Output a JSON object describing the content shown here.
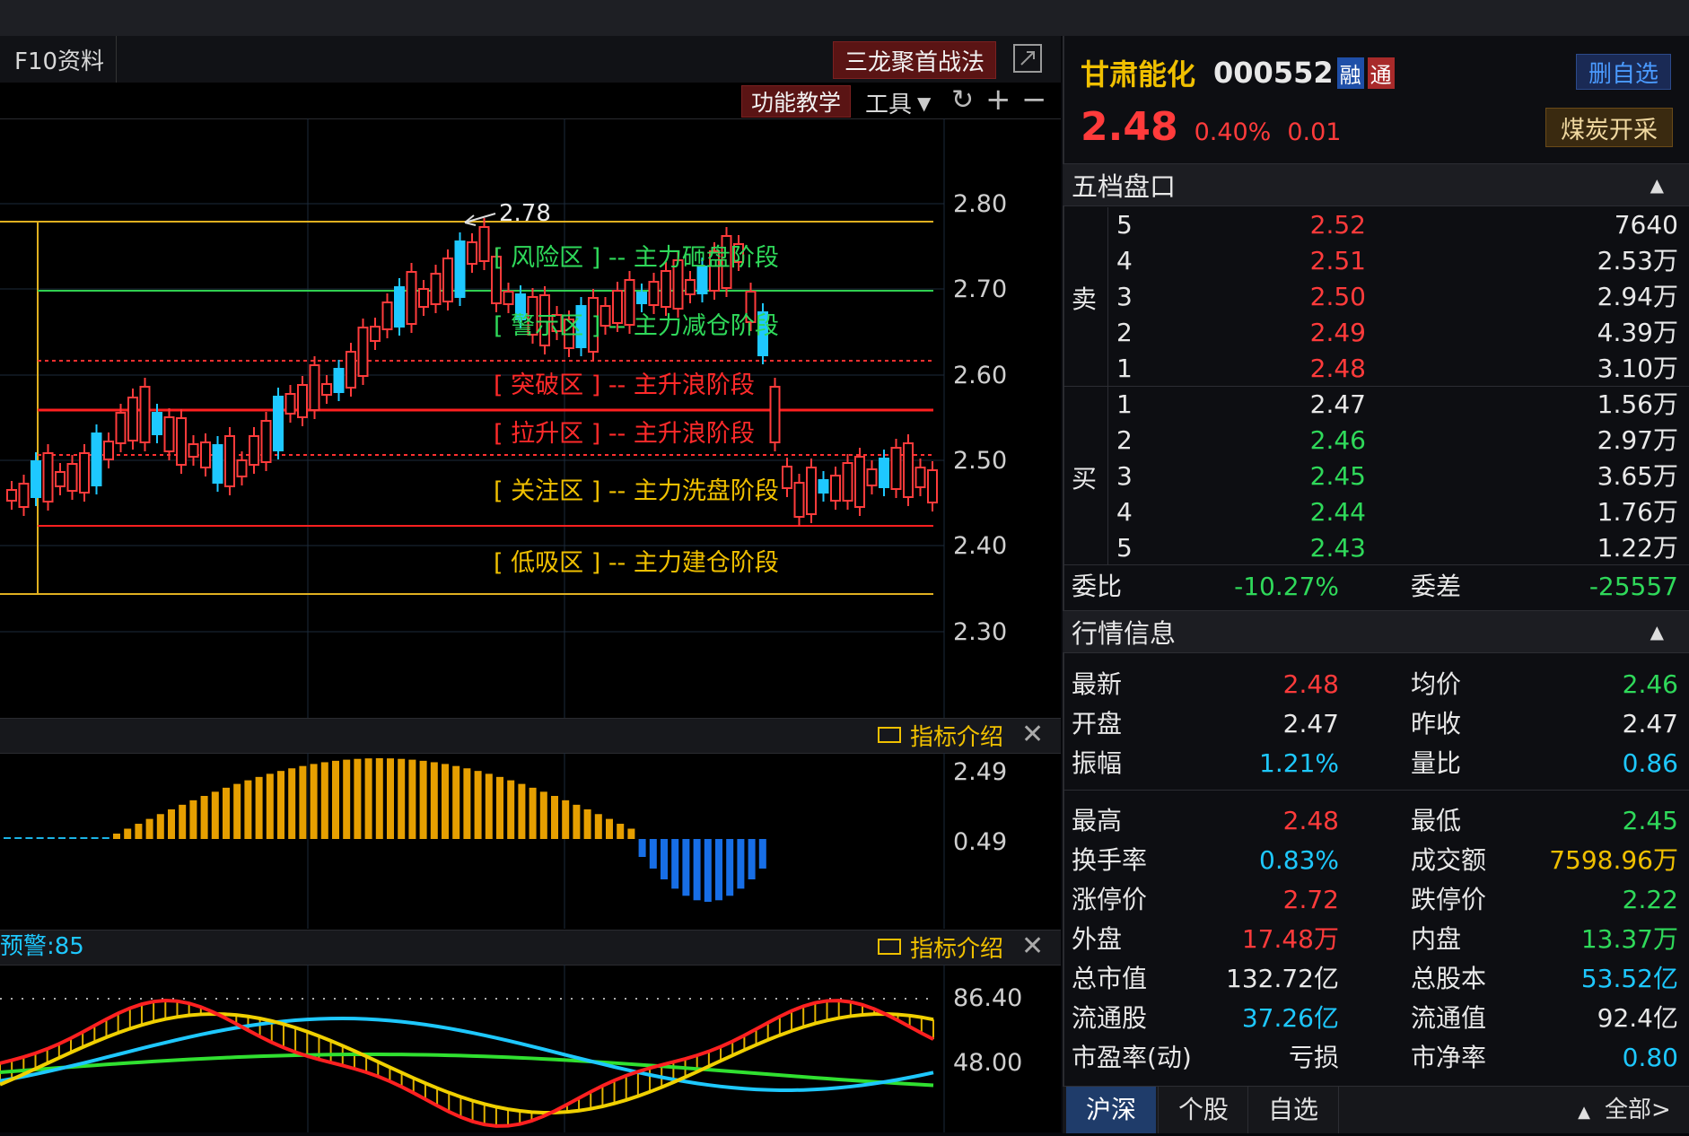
{
  "toolbar": {
    "f10": "F10资料",
    "strategy": "三龙聚首战法",
    "teach": "功能教学",
    "tools": "工具"
  },
  "chart": {
    "price_labels": [
      "2.80",
      "2.70",
      "2.60",
      "2.50",
      "2.40",
      "2.30"
    ],
    "high_marker": "2.78",
    "zones": [
      {
        "text": "[ 风险区 ] -- 主力砸盘阶段",
        "color": "#2fd95a"
      },
      {
        "text": "[ 警示区 ] -- 主力减仓阶段",
        "color": "#2fd95a"
      },
      {
        "text": "[ 突破区 ] -- 主升浪阶段",
        "color": "#ff2a2a"
      },
      {
        "text": "[ 拉升区 ] -- 主升浪阶段",
        "color": "#ff2a2a"
      },
      {
        "text": "[ 关注区 ] -- 主力洗盘阶段",
        "color": "#f0c000"
      },
      {
        "text": "[ 低吸区 ] -- 主力建仓阶段",
        "color": "#f0c000"
      }
    ],
    "ind1_label": "指标介绍",
    "ind1_axis": [
      "2.49",
      "0.49"
    ],
    "ind2_title": "预警:85",
    "ind2_label": "指标介绍",
    "ind2_axis": [
      "86.40",
      "48.00"
    ]
  },
  "stock": {
    "name": "甘肃能化",
    "code": "000552",
    "badge_rong": "融",
    "badge_tong": "通",
    "del_watch": "删自选",
    "price": "2.48",
    "pct": "0.40%",
    "chg": "0.01",
    "sector": "煤炭开采"
  },
  "orderbook": {
    "title": "五档盘口",
    "sell_label": "卖",
    "buy_label": "买",
    "sells": [
      {
        "lvl": "5",
        "price": "2.52",
        "vol": "7640"
      },
      {
        "lvl": "4",
        "price": "2.51",
        "vol": "2.53万"
      },
      {
        "lvl": "3",
        "price": "2.50",
        "vol": "2.94万"
      },
      {
        "lvl": "2",
        "price": "2.49",
        "vol": "4.39万"
      },
      {
        "lvl": "1",
        "price": "2.48",
        "vol": "3.10万"
      }
    ],
    "buys": [
      {
        "lvl": "1",
        "price": "2.47",
        "vol": "1.56万"
      },
      {
        "lvl": "2",
        "price": "2.46",
        "vol": "2.97万"
      },
      {
        "lvl": "3",
        "price": "2.45",
        "vol": "3.65万"
      },
      {
        "lvl": "4",
        "price": "2.44",
        "vol": "1.76万"
      },
      {
        "lvl": "5",
        "price": "2.43",
        "vol": "1.22万"
      }
    ],
    "weibi_label": "委比",
    "weibi": "-10.27%",
    "weicha_label": "委差",
    "weicha": "-25557"
  },
  "quote": {
    "title": "行情信息",
    "rows": [
      {
        "l1": "最新",
        "v1": "2.48",
        "l2": "均价",
        "v2": "2.46"
      },
      {
        "l1": "开盘",
        "v1": "2.47",
        "l2": "昨收",
        "v2": "2.47"
      },
      {
        "l1": "振幅",
        "v1": "1.21%",
        "l2": "量比",
        "v2": "0.86"
      },
      {
        "l1": "最高",
        "v1": "2.48",
        "l2": "最低",
        "v2": "2.45"
      },
      {
        "l1": "换手率",
        "v1": "0.83%",
        "l2": "成交额",
        "v2": "7598.96万"
      },
      {
        "l1": "涨停价",
        "v1": "2.72",
        "l2": "跌停价",
        "v2": "2.22"
      },
      {
        "l1": "外盘",
        "v1": "17.48万",
        "l2": "内盘",
        "v2": "13.37万"
      },
      {
        "l1": "总市值",
        "v1": "132.72亿",
        "l2": "总股本",
        "v2": "53.52亿"
      },
      {
        "l1": "流通股",
        "v1": "37.26亿",
        "l2": "流通值",
        "v2": "92.4亿"
      },
      {
        "l1": "市盈率(动)",
        "v1": "亏损",
        "l2": "市净率",
        "v2": "0.80"
      }
    ]
  },
  "bottom_tabs": [
    "沪深",
    "个股",
    "自选"
  ],
  "bottom_all": "全部>",
  "colors": {
    "up": "#ff3b3b",
    "down": "#2fd95a",
    "cyan": "#1ec8ff"
  }
}
